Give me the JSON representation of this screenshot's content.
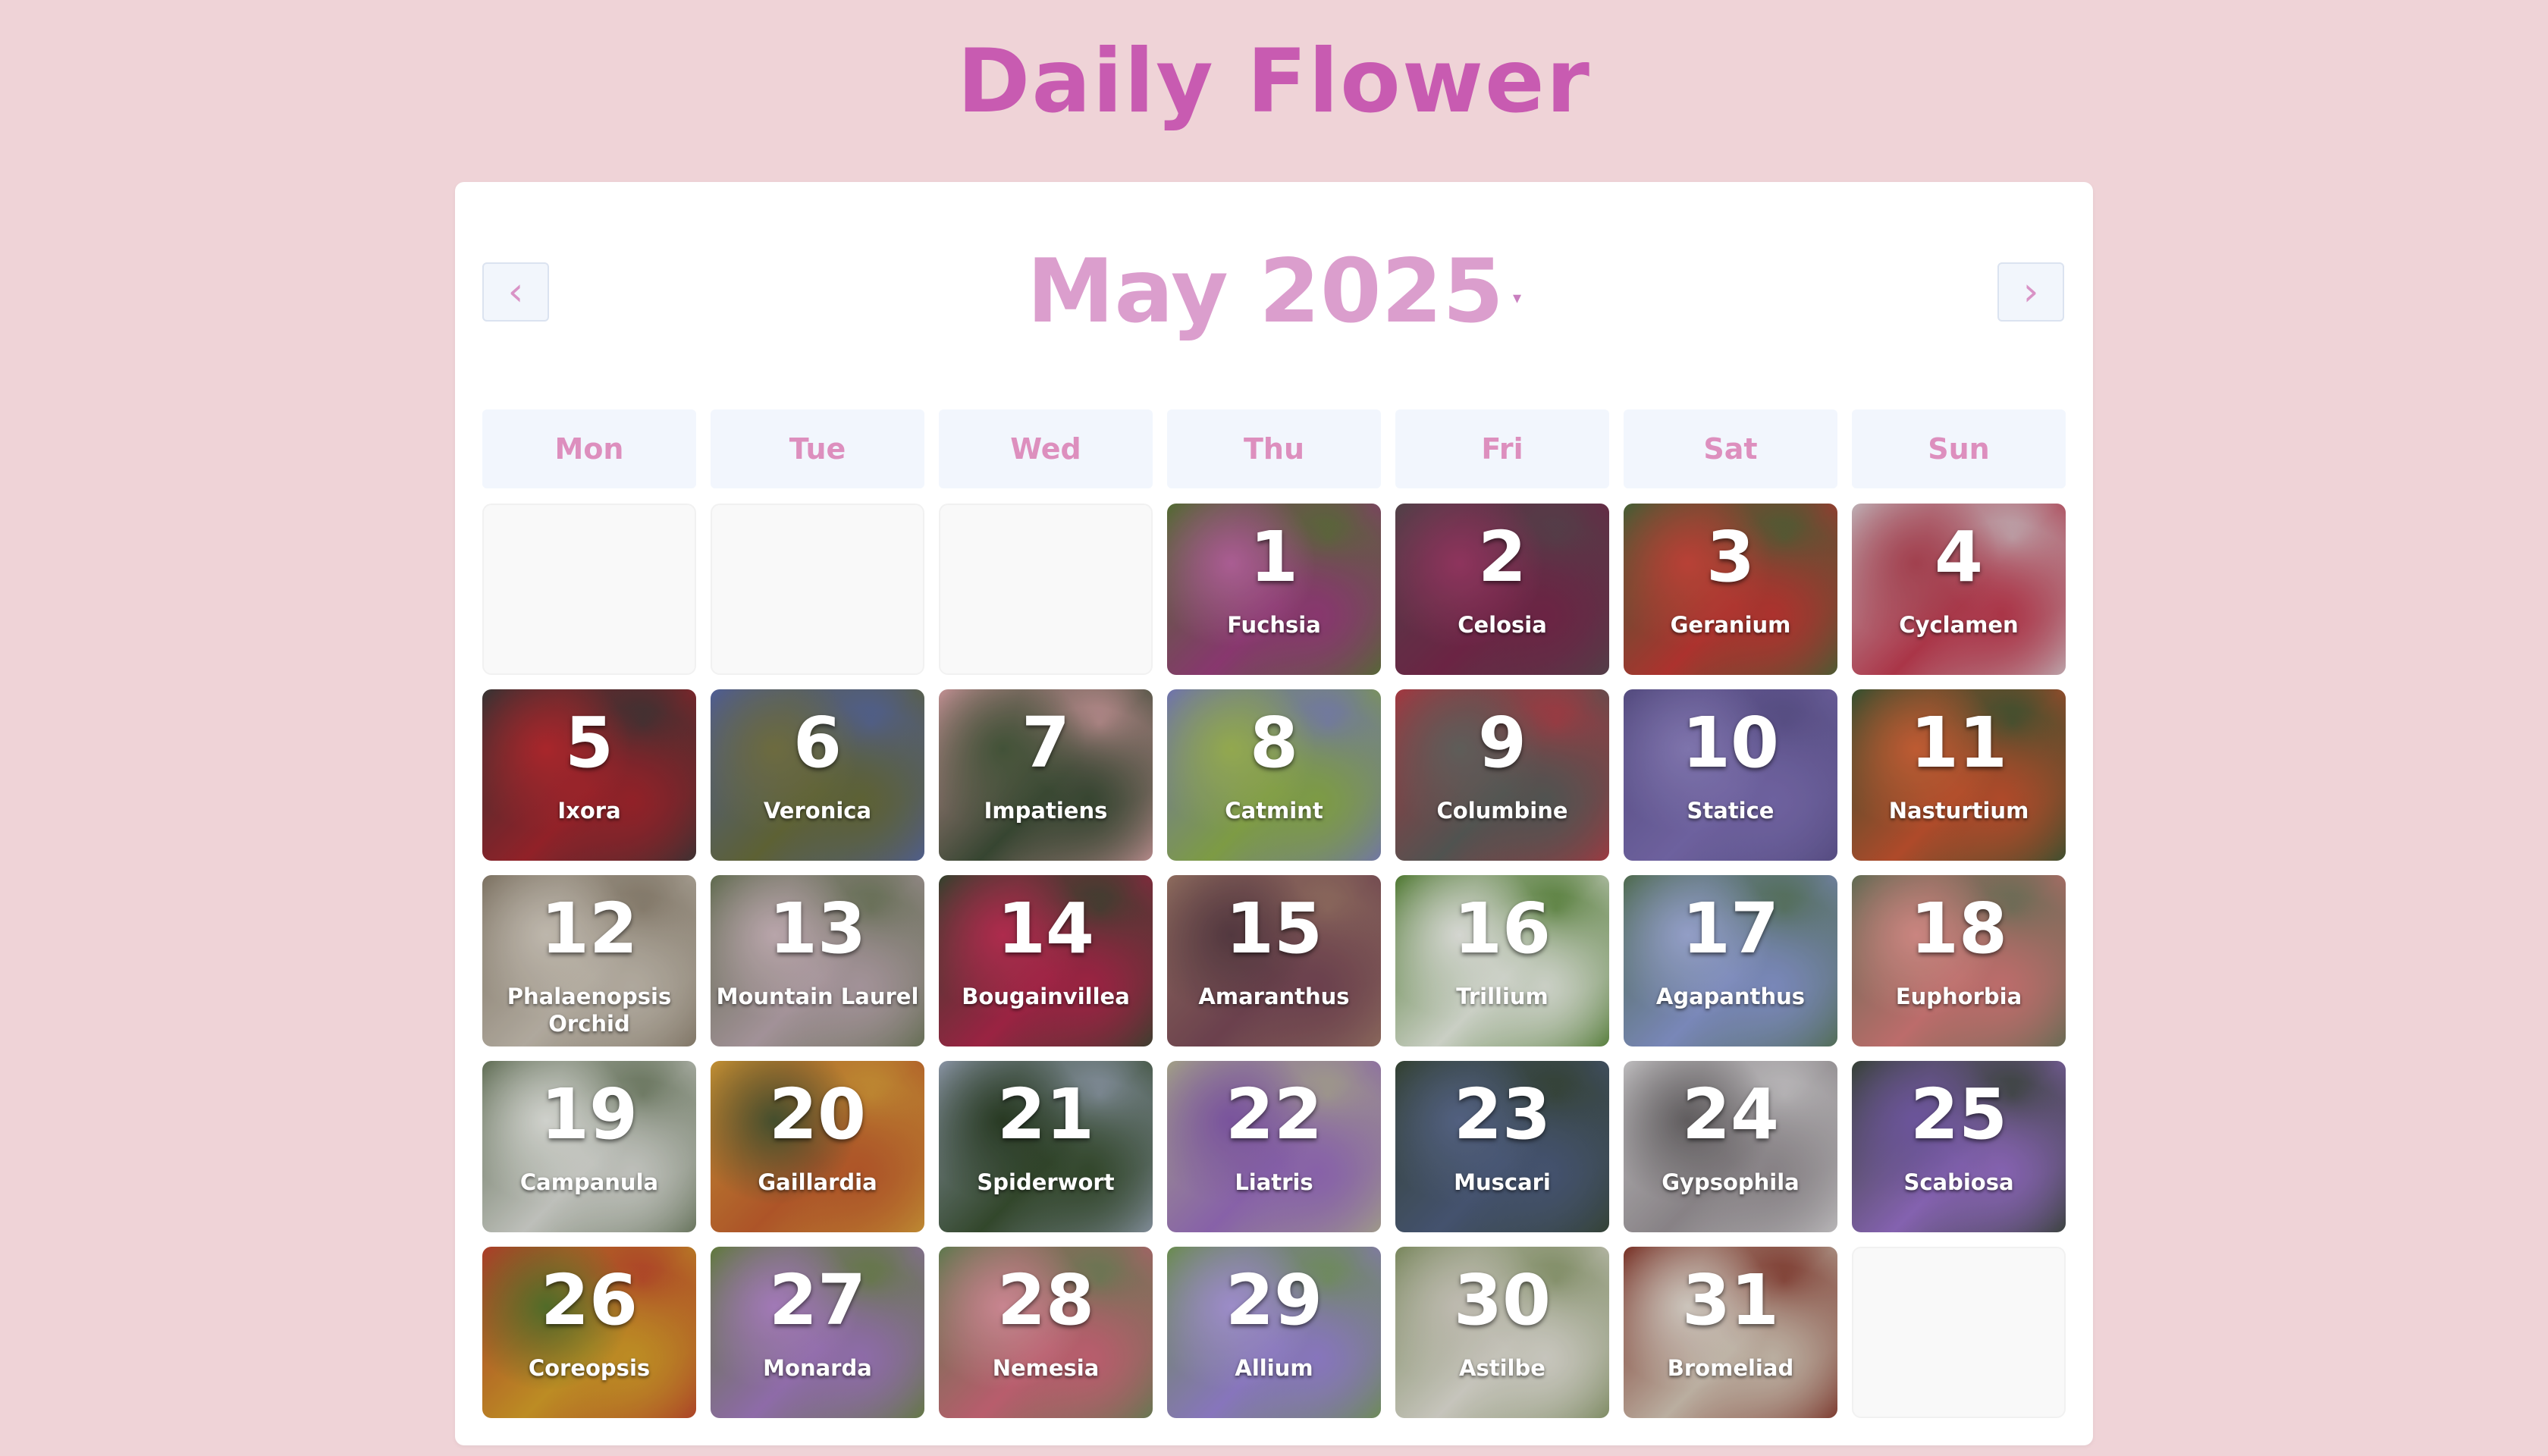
{
  "app": {
    "title": "Daily Flower"
  },
  "calendar": {
    "month_label": "May 2025",
    "prev_icon": "‹",
    "next_icon": "›",
    "caret_icon": "▾",
    "weekdays": [
      "Mon",
      "Tue",
      "Wed",
      "Thu",
      "Fri",
      "Sat",
      "Sun"
    ],
    "leading_empty": 3,
    "trailing_empty": 1,
    "days": [
      {
        "day": "1",
        "flower": "Fuchsia",
        "colors": [
          "#9b3f7e",
          "#5f7a3a",
          "#c26aa7"
        ]
      },
      {
        "day": "2",
        "flower": "Celosia",
        "colors": [
          "#7a2a4e",
          "#5c4a52",
          "#a23c6a"
        ]
      },
      {
        "day": "3",
        "flower": "Geranium",
        "colors": [
          "#c43a35",
          "#4f6b3c",
          "#d24a3e"
        ]
      },
      {
        "day": "4",
        "flower": "Cyclamen",
        "colors": [
          "#c23d52",
          "#d8c6cc",
          "#b84a5a"
        ]
      },
      {
        "day": "5",
        "flower": "Ixora",
        "colors": [
          "#a5262e",
          "#3f3a3a",
          "#c02c32"
        ]
      },
      {
        "day": "6",
        "flower": "Veronica",
        "colors": [
          "#6a6f3c",
          "#5a6aa8",
          "#7c7a48"
        ]
      },
      {
        "day": "7",
        "flower": "Impatiens",
        "colors": [
          "#3e4f38",
          "#d9a2a5",
          "#4c5e40"
        ]
      },
      {
        "day": "8",
        "flower": "Catmint",
        "colors": [
          "#8fb14e",
          "#7f84c4",
          "#a7c05a"
        ]
      },
      {
        "day": "9",
        "flower": "Columbine",
        "colors": [
          "#5c5f5c",
          "#b9404a",
          "#6c6a66"
        ]
      },
      {
        "day": "10",
        "flower": "Statice",
        "colors": [
          "#7d6fb4",
          "#5f5590",
          "#9084c4"
        ]
      },
      {
        "day": "11",
        "flower": "Nasturtium",
        "colors": [
          "#c75530",
          "#3d5b36",
          "#d8683a"
        ]
      },
      {
        "day": "12",
        "flower": "Phalaenopsis Orchid",
        "colors": [
          "#c8c0b3",
          "#8e8270",
          "#d8d0c4"
        ]
      },
      {
        "day": "13",
        "flower": "Mountain Laurel",
        "colors": [
          "#b9a6ad",
          "#6e7a5a",
          "#d2bcc2"
        ]
      },
      {
        "day": "14",
        "flower": "Bougainvillea",
        "colors": [
          "#b0284c",
          "#3e4a34",
          "#c63258"
        ]
      },
      {
        "day": "15",
        "flower": "Amaranthus",
        "colors": [
          "#7a4a58",
          "#a07a6a",
          "#5e4048"
        ]
      },
      {
        "day": "16",
        "flower": "Trillium",
        "colors": [
          "#e6ece0",
          "#5b8a3a",
          "#f2f4ee"
        ]
      },
      {
        "day": "17",
        "flower": "Agapanthus",
        "colors": [
          "#8a9ad2",
          "#5a7a5a",
          "#a7b4e2"
        ]
      },
      {
        "day": "18",
        "flower": "Euphorbia",
        "colors": [
          "#d67c7a",
          "#6f7a5e",
          "#e69892"
        ]
      },
      {
        "day": "19",
        "flower": "Campanula",
        "colors": [
          "#d8dad4",
          "#6f7e62",
          "#eceee8"
        ]
      },
      {
        "day": "20",
        "flower": "Gaillardia",
        "colors": [
          "#c5602e",
          "#d9a23a",
          "#4e5a34"
        ]
      },
      {
        "day": "21",
        "flower": "Spiderwort",
        "colors": [
          "#3a5132",
          "#9aa6b8",
          "#2e4228"
        ]
      },
      {
        "day": "22",
        "flower": "Liatris",
        "colors": [
          "#9a6fc0",
          "#b7b49a",
          "#8a5fb2"
        ]
      },
      {
        "day": "23",
        "flower": "Muscari",
        "colors": [
          "#4e5e7e",
          "#3a4a38",
          "#5e6e92"
        ]
      },
      {
        "day": "24",
        "flower": "Gypsophila",
        "colors": [
          "#9a9498",
          "#d6d4d6",
          "#6e6a6c"
        ]
      },
      {
        "day": "25",
        "flower": "Scabiosa",
        "colors": [
          "#9770c8",
          "#3e4a3e",
          "#7a60b0"
        ]
      },
      {
        "day": "26",
        "flower": "Coreopsis",
        "colors": [
          "#d6a02a",
          "#c2452e",
          "#5c7a2e"
        ]
      },
      {
        "day": "27",
        "flower": "Monarda",
        "colors": [
          "#a27ac0",
          "#6e8a46",
          "#b88ad0"
        ]
      },
      {
        "day": "28",
        "flower": "Nemesia",
        "colors": [
          "#d26a7c",
          "#6e8a5a",
          "#e498a4"
        ]
      },
      {
        "day": "29",
        "flower": "Allium",
        "colors": [
          "#9a86d6",
          "#7aa05c",
          "#b2a0e4"
        ]
      },
      {
        "day": "30",
        "flower": "Astilbe",
        "colors": [
          "#e2e0d6",
          "#8a9a6a",
          "#d8d4c8"
        ]
      },
      {
        "day": "31",
        "flower": "Bromeliad",
        "colors": [
          "#d4c6b6",
          "#8a3a2e",
          "#e8e0d6"
        ]
      }
    ]
  }
}
